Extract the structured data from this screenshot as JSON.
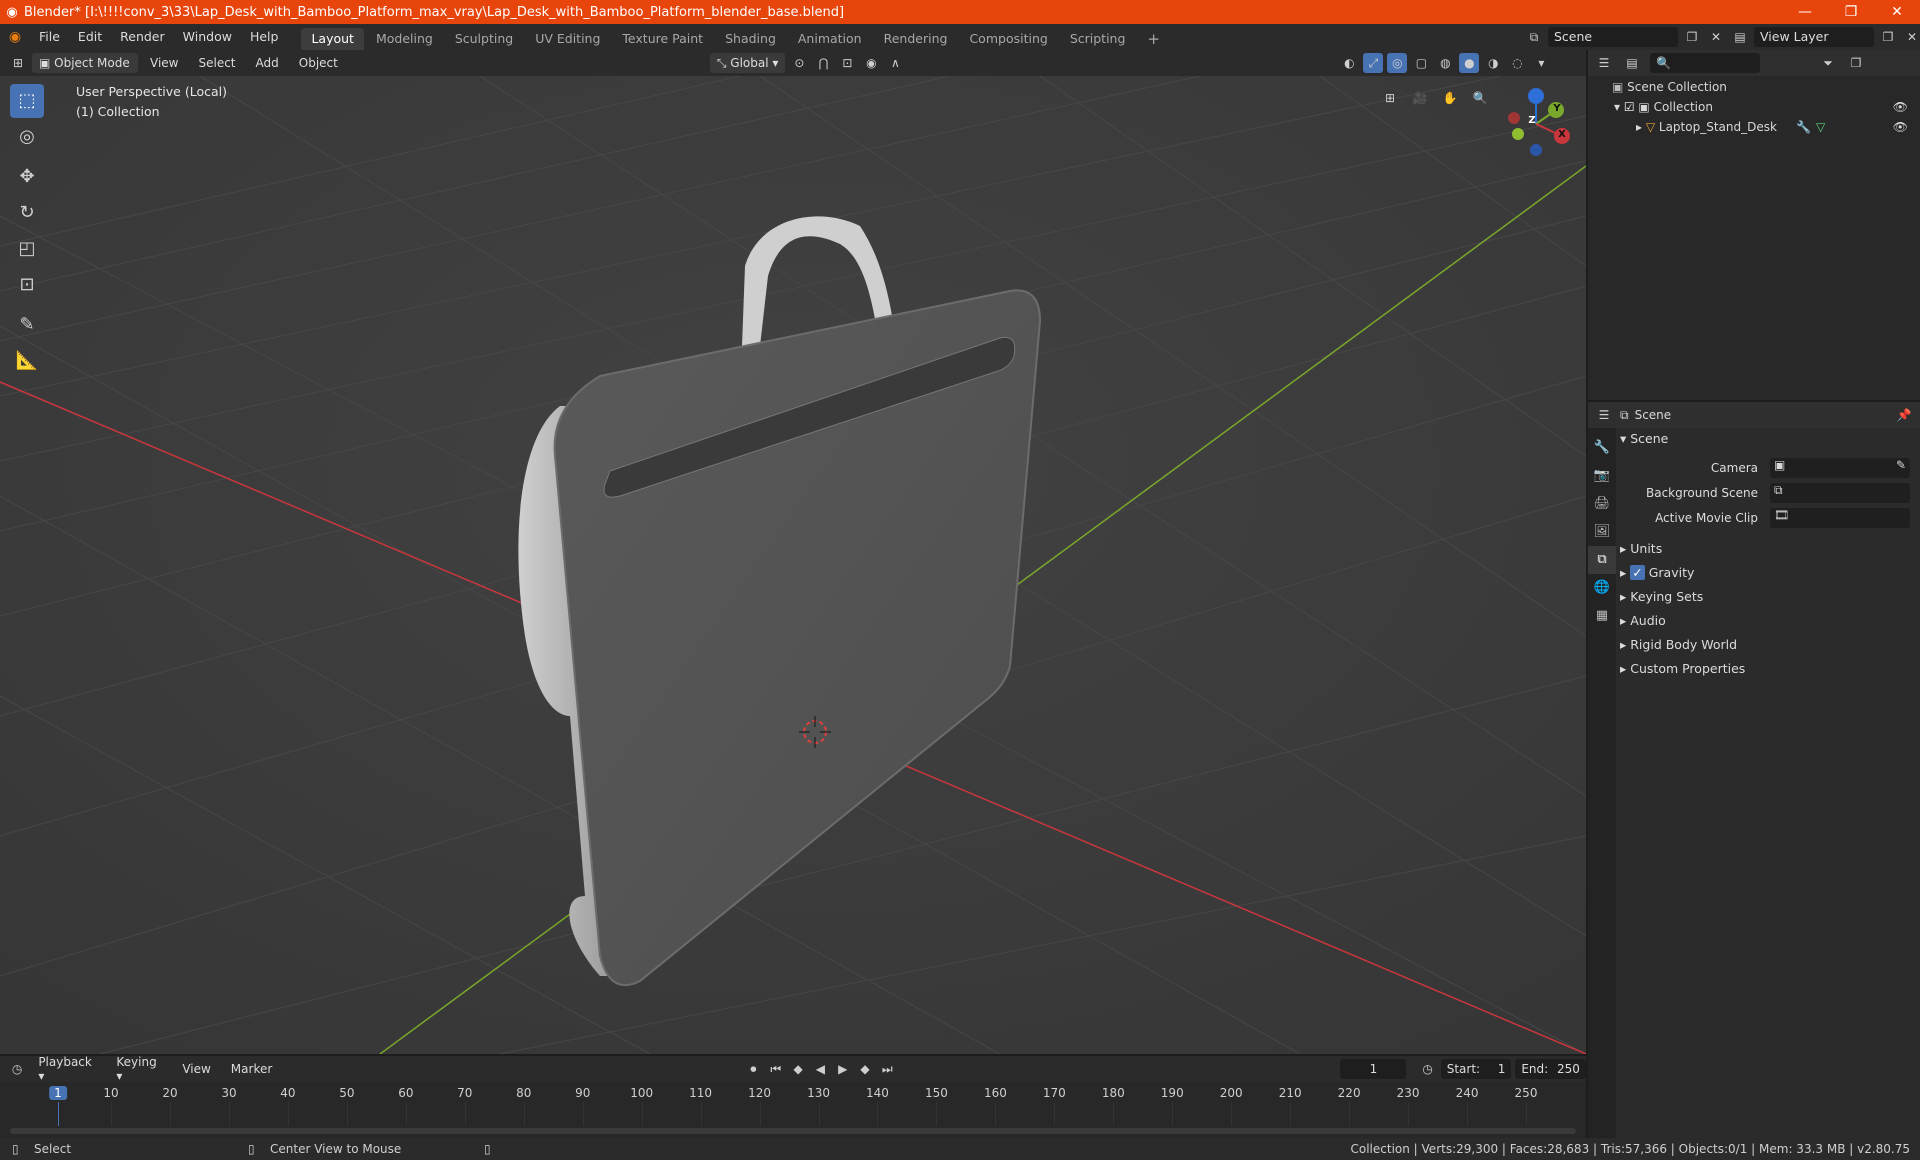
{
  "titlebar": {
    "title": "Blender* [I:\\!!!!conv_3\\33\\Lap_Desk_with_Bamboo_Platform_max_vray\\Lap_Desk_with_Bamboo_Platform_blender_base.blend]",
    "minimize": "—",
    "maximize": "❐",
    "close": "✕"
  },
  "menu": [
    "File",
    "Edit",
    "Render",
    "Window",
    "Help"
  ],
  "workspaces": [
    "Layout",
    "Modeling",
    "Sculpting",
    "UV Editing",
    "Texture Paint",
    "Shading",
    "Animation",
    "Rendering",
    "Compositing",
    "Scripting"
  ],
  "scene_name": "Scene",
  "view_layer": "View Layer",
  "viewport_header": {
    "mode": "Object Mode",
    "menus": [
      "View",
      "Select",
      "Add",
      "Object"
    ],
    "transform": "Global"
  },
  "viewport": {
    "perspective": "User Perspective (Local)",
    "collection": "(1) Collection",
    "gizmo": {
      "z": "Z",
      "y": "Y",
      "x": "X"
    }
  },
  "outliner": {
    "root": "Scene Collection",
    "collection": "Collection",
    "object": "Laptop_Stand_Desk"
  },
  "properties": {
    "header": "Scene",
    "section": "Scene",
    "camera_label": "Camera",
    "bg_scene_label": "Background Scene",
    "movie_clip_label": "Active Movie Clip",
    "panels": [
      "Units",
      "Gravity",
      "Keying Sets",
      "Audio",
      "Rigid Body World",
      "Custom Properties"
    ]
  },
  "timeline": {
    "menus": [
      "Playback",
      "Keying",
      "View",
      "Marker"
    ],
    "current_frame": "1",
    "start_label": "Start:",
    "start": "1",
    "end_label": "End:",
    "end": "250",
    "ticks": [
      "1",
      "10",
      "20",
      "30",
      "40",
      "50",
      "60",
      "70",
      "80",
      "90",
      "100",
      "110",
      "120",
      "130",
      "140",
      "150",
      "160",
      "170",
      "180",
      "190",
      "200",
      "210",
      "220",
      "230",
      "240",
      "250"
    ]
  },
  "status": {
    "select": "Select",
    "center": "Center View to Mouse",
    "stats": "Collection | Verts:29,300 | Faces:28,683 | Tris:57,366 | Objects:0/1 | Mem: 33.3 MB | v2.80.75"
  },
  "colors": {
    "accent": "#4772b3",
    "titlebar": "#e8450c",
    "x_axis": "#c9373d",
    "y_axis": "#7aa82a"
  }
}
